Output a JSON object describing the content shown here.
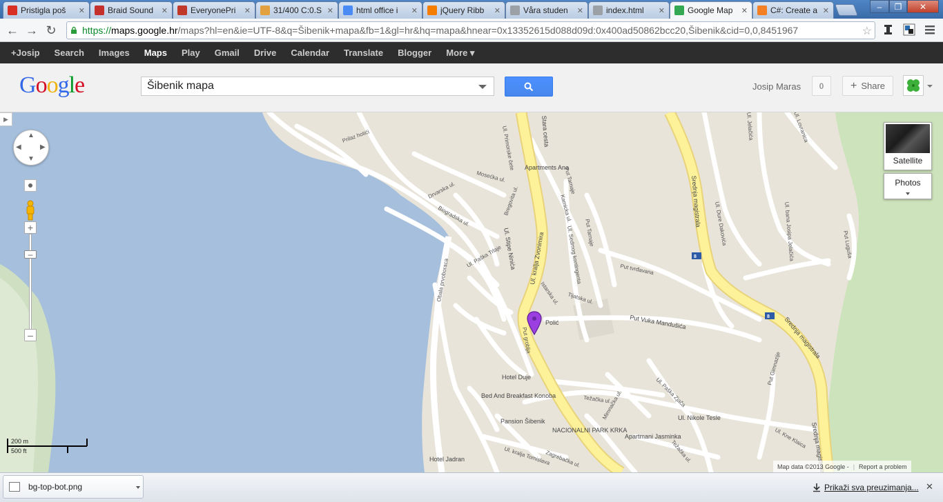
{
  "browser": {
    "tabs": [
      {
        "title": "Pristigla poš",
        "icon": "gmail-icon",
        "color": "#d93025",
        "active": false
      },
      {
        "title": "Braid Sound",
        "icon": "youtube-icon",
        "color": "#c4302b",
        "active": false
      },
      {
        "title": "EveryonePri",
        "icon": "everyone-icon",
        "color": "#c0392b",
        "active": false
      },
      {
        "title": "31/400 C:0.S",
        "icon": "task-icon",
        "color": "#e2a03f",
        "active": false
      },
      {
        "title": "html office i",
        "icon": "google-icon",
        "color": "#4a8af4",
        "active": false
      },
      {
        "title": "jQuery Ribb",
        "icon": "blogger-icon",
        "color": "#f57d00",
        "active": false
      },
      {
        "title": "Våra studen",
        "icon": "page-icon",
        "color": "#9aa0a6",
        "active": false
      },
      {
        "title": "index.html",
        "icon": "page-icon",
        "color": "#9aa0a6",
        "active": false
      },
      {
        "title": "Google Map",
        "icon": "maps-icon",
        "color": "#34a853",
        "active": true
      },
      {
        "title": "C#: Create a",
        "icon": "stackoverflow-icon",
        "color": "#f48024",
        "active": false
      }
    ],
    "url": {
      "scheme": "https://",
      "host": "maps.google.hr",
      "path": "/maps?hl=en&ie=UTF-8&q=Šibenik+mapa&fb=1&gl=hr&hq=mapa&hnear=0x13352615d088d09d:0x400ad50862bcc20,Šibenik&cid=0,0,8451967"
    }
  },
  "gbar": {
    "items": [
      "+Josip",
      "Search",
      "Images",
      "Maps",
      "Play",
      "Gmail",
      "Drive",
      "Calendar",
      "Translate",
      "Blogger",
      "More ▾"
    ],
    "selected": "Maps"
  },
  "header": {
    "logo": "Google",
    "search_value": "Šibenik mapa",
    "user_name": "Josip Maras",
    "notification_count": "0",
    "share_label": "Share"
  },
  "map": {
    "satellite_label": "Satellite",
    "photos_label": "Photos",
    "scale_metric": "200 m",
    "scale_imperial": "500 ft",
    "attribution": "Map data ©2013 Google -",
    "report_label": "Report a problem",
    "colors": {
      "water": "#a5bfdd",
      "land": "#e8e4da",
      "park": "#cde3bb",
      "highway": "#fdf29a",
      "road": "#ffffff",
      "marker": "#9b3fe0"
    },
    "labels": {
      "prilaz_hoti": "Prilaz hotići",
      "primorske_cete": "Ul. Primorske čete",
      "stara_cesta": "Stara cesta",
      "kralja_zvonimira": "Ul. kralja Zvonimira",
      "apartments_ana": "Apartments Ana",
      "mosecka": "Mosećka ul.",
      "drvarska": "Drvarska ul.",
      "biogradska": "Biogradska ul.",
      "bregovita": "Bregovita ul.",
      "put_tarnaje": "Put Tarnaje",
      "kamicka": "Kamicka ul.",
      "sedmog_kontingenta": "Ul. Sedmog kontingenta",
      "pastla_triaje": "Ul. Paška Trlaje",
      "stipe_ninica": "Ul. Stipe Ninića",
      "obala_prvoboraca": "Obala prvoboraca",
      "put_ivrdavana": "Put tvrđavana",
      "istarska": "Istarska ul.",
      "tijatska": "Tijatska ul.",
      "put_vuka_manducica": "Put Vuka Mandušića",
      "srednja_magistrala": "Srednja magistrala",
      "dure_dakovica": "Ul. Dure Dakovića",
      "bana_jelacica": "Ul. bana Josipa Jelačića",
      "put_lugusa": "Put Luguša",
      "ul_jelacica_top": "Ul. Jelačića",
      "ul_lovranica": "Ul. Lovranica",
      "polic": "Polić",
      "put_groblja": "Put groblja",
      "hotel_duje": "Hotel Duje",
      "bed_and_breakfast": "Bed And Breakfast Konoba",
      "pension_sibenik": "Pansion Šibenik",
      "nacionalni_park": "NACIONALNI PARK KRKA",
      "tezacka": "Težačka ul.",
      "mimnacka": "Mimnačka ul.",
      "nikole_tesle": "Ul. Nikole Tesle",
      "put_gimnazije": "Put Gimnazije",
      "ulica_kraca": "Ul. Kne Klaica",
      "paska_zjaca": "Ul. Paška Zjača",
      "apartmani_jasminka": "Apartmani Jasminka",
      "tezacka_lower": "Težačka ul.",
      "hotel_jadran": "Hotel Jadran",
      "kralja_tomislava": "Ul. kralja Tomislava",
      "zagrebacka": "Zagrebačka ul.",
      "road_number": "8"
    }
  },
  "downloads": {
    "file_name": "bg-top-bot.png",
    "show_all": "Prikaži sva preuzimanja..."
  }
}
